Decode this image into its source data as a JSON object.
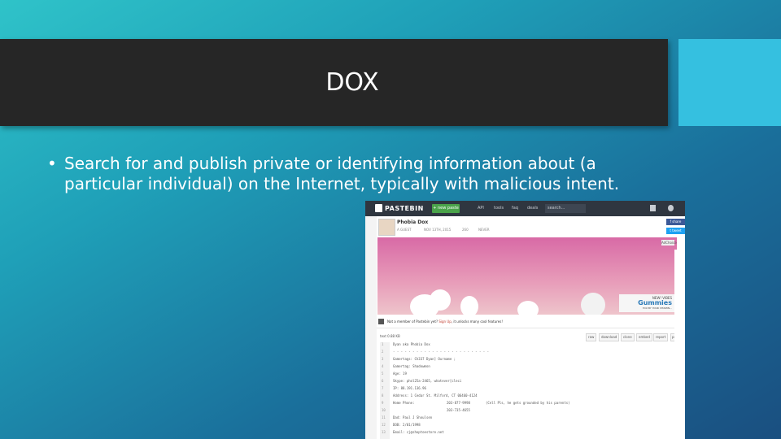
{
  "slide": {
    "title": "DOX",
    "bullet_symbol": "•",
    "bullet_text": "Search for and publish private or identifying information about (a particular individual) on the Internet, typically with malicious intent.",
    "colors": {
      "title_bar": "#262626",
      "accent": "#35c0e0"
    }
  },
  "screenshot": {
    "logo": "PASTEBIN",
    "new_paste": "+ new paste",
    "nav": [
      "API",
      "tools",
      "faq",
      "deals"
    ],
    "search_placeholder": "search...",
    "user_name": "Phobia Dox",
    "meta": [
      "A GUEST",
      "NOV 13TH, 2015",
      "260",
      "NEVER"
    ],
    "share": [
      "f share",
      "t tweet"
    ],
    "ad": {
      "close": "AdChoices",
      "brand_top": "NEW! VIBES",
      "brand": "Gummies",
      "brand_bottom": "YOU BY YOUR VITAMIN..."
    },
    "notice": {
      "prefix": "Not a member of Pastebin yet? ",
      "link": "Sign Up",
      "suffix": ", it unlocks many cool features!"
    },
    "toolbar": {
      "size": "text  0.88 KB",
      "buttons": [
        "raw",
        "download",
        "clone",
        "embed",
        "report",
        "print"
      ]
    },
    "code_lines": [
      {
        "n": "1",
        "t": "Dyan aka Phobia Dox"
      },
      {
        "n": "2",
        "t": "- - - - - - - - - - - - - - - - - - - - - - - - -"
      },
      {
        "n": "3",
        "t": "Gamertags: Ch337 Dyan] Ourname ;"
      },
      {
        "n": "4",
        "t": "Gamertag: Shadowmon"
      },
      {
        "n": "5",
        "t": "Age: 19"
      },
      {
        "n": "6",
        "t": "Skype: phol25a-2465, whatever[cleci"
      },
      {
        "n": "7",
        "t": "IP: 88.191.136.96"
      },
      {
        "n": "8",
        "t": "Address: 1 Cedar St. Milford, CT 06460-4124"
      },
      {
        "n": "9",
        "t": "Home Phone:",
        "c2": "203-877-9998",
        "c3": "(Cell Pls, he gets grounded by his parents)"
      },
      {
        "n": "10",
        "t": "",
        "c2": "203-735-4655"
      },
      {
        "n": "11",
        "t": "Dad: Paul J Shoulsen"
      },
      {
        "n": "12",
        "t": "DOB: 2/01/1998"
      },
      {
        "n": "13",
        "t": "Email: cj@shoptoestore.net"
      }
    ]
  }
}
